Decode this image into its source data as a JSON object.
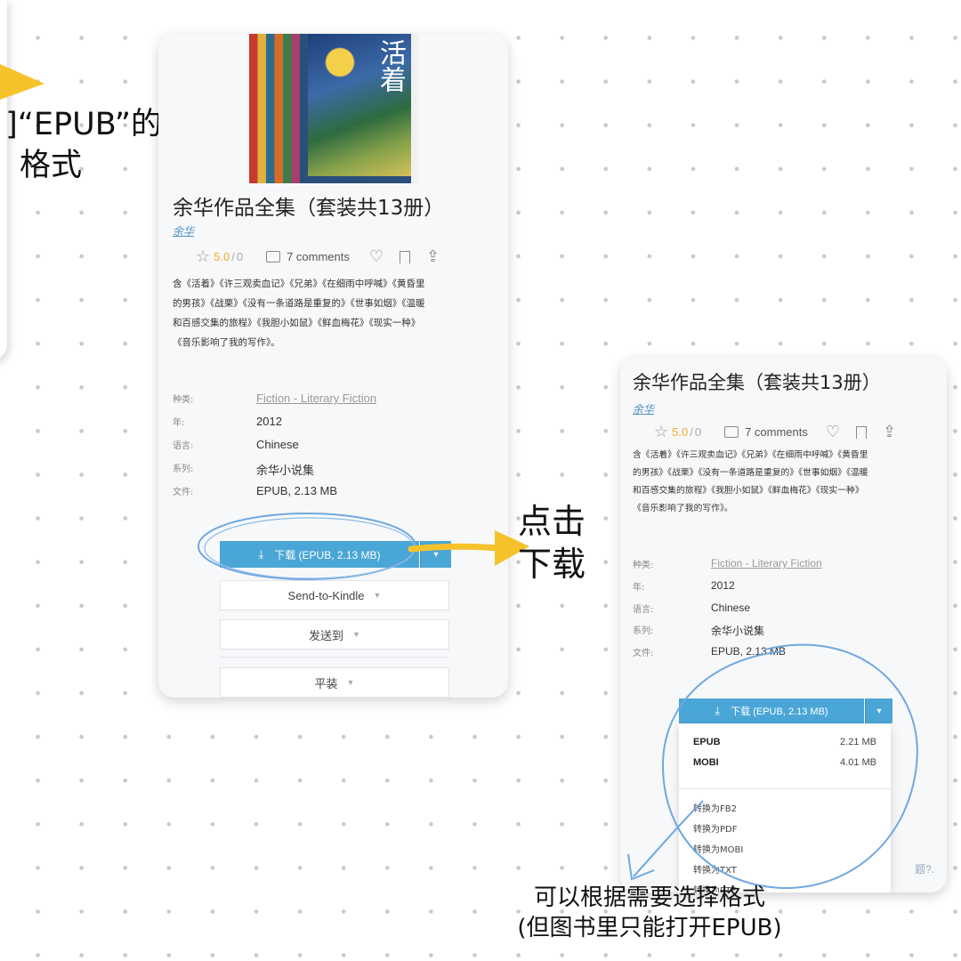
{
  "left_annotation": {
    "line1": "]“EPUB”的",
    "line2": "格式"
  },
  "card1": {
    "cover_title": "活着",
    "book_title": "余华作品全集（套装共13册）",
    "author": "余华",
    "rating": "5.0",
    "rating_sep": "/",
    "rating_count": "0",
    "comments": "7 comments",
    "description": [
      "含《活着》《许三观卖血记》《兄弟》《在细雨中呼喊》《黄昏里",
      "的男孩》《战栗》《没有一条道路是重复的》《世事如烟》《温暖",
      "和百感交集的旅程》《我胆小如鼠》《鲜血梅花》《现实一种》",
      "《音乐影响了我的写作》。"
    ],
    "details": [
      {
        "key": "种类:",
        "value": "Fiction - Literary Fiction"
      },
      {
        "key": "年:",
        "value": "2012"
      },
      {
        "key": "语言:",
        "value": "Chinese"
      },
      {
        "key": "系列:",
        "value": "余华小说集"
      },
      {
        "key": "文件:",
        "value": "EPUB, 2.13 MB"
      }
    ],
    "download_label": "下载 (EPUB, 2.13 MB)",
    "send_to_kindle": "Send-to-Kindle",
    "send_to": "发送到",
    "binding": "平装"
  },
  "click_annotation": {
    "line1": "点击",
    "line2": "下载"
  },
  "card2": {
    "book_title": "余华作品全集（套装共13册）",
    "author": "余华",
    "rating": "5.0",
    "rating_sep": "/",
    "rating_count": "0",
    "comments": "7 comments",
    "description": [
      "含《活着》《许三观卖血记》《兄弟》《在细雨中呼喊》《黄昏里",
      "的男孩》《战栗》《没有一条道路是重复的》《世事如烟》《温暖",
      "和百感交集的旅程》《我胆小如鼠》《鲜血梅花》《现实一种》",
      "《音乐影响了我的写作》。"
    ],
    "details": [
      {
        "key": "种类:",
        "value": "Fiction - Literary Fiction"
      },
      {
        "key": "年:",
        "value": "2012"
      },
      {
        "key": "语言:",
        "value": "Chinese"
      },
      {
        "key": "系列:",
        "value": "余华小说集"
      },
      {
        "key": "文件:",
        "value": "EPUB, 2.13 MB"
      }
    ],
    "download_label": "下载 (EPUB, 2.13 MB)",
    "formats": [
      {
        "name": "EPUB",
        "size": "2.21 MB"
      },
      {
        "name": "MOBI",
        "size": "4.01 MB"
      }
    ],
    "conversions": [
      "转换为FB2",
      "转换为PDF",
      "转换为MOBI",
      "转换为TXT",
      "转换为RTF"
    ],
    "footer_partial": "题?."
  },
  "bottom_annotation": {
    "line1": "可以根据需要选择格式",
    "line2": "(但图书里只能打开EPUB)"
  },
  "colors": {
    "accent": "#4aa6d6",
    "highlight": "#f5c22b",
    "scribble": "#6fa8e0",
    "rating": "#f0ad2c"
  }
}
